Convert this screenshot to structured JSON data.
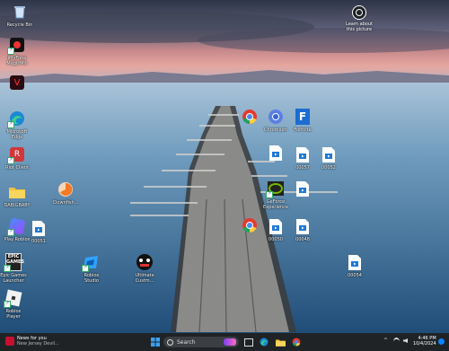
{
  "desktop": {
    "icons": [
      {
        "id": "recycle",
        "label": "Recycle Bin"
      },
      {
        "id": "magicmic",
        "label": "iMyFone\nMagicMic"
      },
      {
        "id": "gem",
        "label": ""
      },
      {
        "id": "edge",
        "label": "Microsoft\nEdge"
      },
      {
        "id": "riot",
        "label": "Riot Client"
      },
      {
        "id": "folder",
        "label": "DABIGBABY"
      },
      {
        "id": "clownfish",
        "label": "Clownfish..."
      },
      {
        "id": "playroblox",
        "label": "Play Roblox"
      },
      {
        "id": "file00051a",
        "label": "00051"
      },
      {
        "id": "epic",
        "label": "Epic Games\nLauncher"
      },
      {
        "id": "robloxstudio",
        "label": "Roblox\nStudio"
      },
      {
        "id": "ultimate",
        "label": "Ultimate\nCustm..."
      },
      {
        "id": "robloxplayer",
        "label": "Roblox\nPlayer"
      },
      {
        "id": "chrome1",
        "label": ""
      },
      {
        "id": "chromium",
        "label": "Chromium"
      },
      {
        "id": "fortnite",
        "label": "Fortnite"
      },
      {
        "id": "file_unl",
        "label": ""
      },
      {
        "id": "file00057",
        "label": "00057"
      },
      {
        "id": "file00052",
        "label": "00052"
      },
      {
        "id": "nvidia",
        "label": "GeForce\nExperience"
      },
      {
        "id": "file_mid",
        "label": ""
      },
      {
        "id": "chrome2",
        "label": ""
      },
      {
        "id": "file00050",
        "label": "00050"
      },
      {
        "id": "file00048",
        "label": "00048"
      },
      {
        "id": "file00054",
        "label": "00054"
      }
    ],
    "learn": {
      "label": "Learn about\nthis picture"
    }
  },
  "taskbar": {
    "news_title": "News for you",
    "news_subtitle": "New Jersey Devil...",
    "search_placeholder": "Search",
    "time": "4:46 PM",
    "date": "10/4/2024",
    "tray_chevron": "^"
  },
  "colors": {
    "taskbar": "#1f2326",
    "accent": "#0a84ff"
  }
}
